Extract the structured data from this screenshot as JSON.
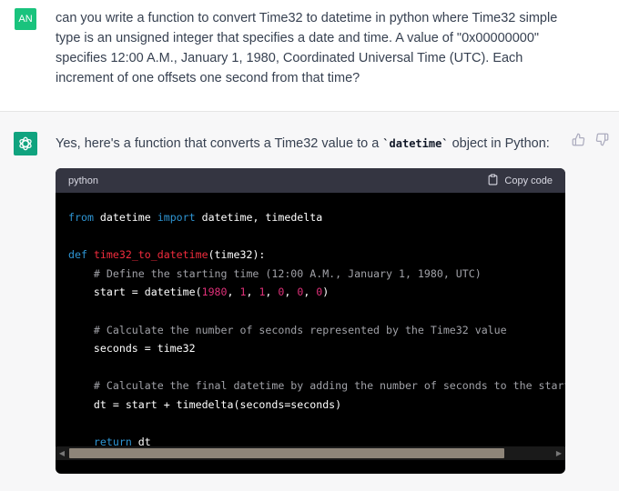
{
  "colors": {
    "user_avatar": "#19c37d",
    "gpt_avatar": "#10a37f",
    "code_bg": "#000000",
    "code_header": "#343541"
  },
  "user_message": {
    "avatar_initials": "AN",
    "text": "can you write a function to convert Time32  to datetime in python where Time32 simple type is an unsigned integer that specifies a date and time. A value of \"0x00000000\" specifies 12:00 A.M., January 1, 1980, Coordinated Universal Time (UTC). Each increment of one offsets one second from that time?"
  },
  "assistant_message": {
    "avatar_icon": "openai-logo-icon",
    "intro_before": "Yes, here's a function that converts a Time32 value to a ",
    "intro_code": "`datetime`",
    "intro_after": " object in Python:",
    "feedback_icons": [
      "thumbs-up-icon",
      "thumbs-down-icon"
    ]
  },
  "code_block": {
    "language": "python",
    "copy_label": "Copy code",
    "lines": [
      [
        {
          "t": "from",
          "c": "kw"
        },
        {
          "t": " datetime "
        },
        {
          "t": "import",
          "c": "kw"
        },
        {
          "t": " datetime, timedelta"
        }
      ],
      [],
      [
        {
          "t": "def",
          "c": "kw"
        },
        {
          "t": " "
        },
        {
          "t": "time32_to_datetime",
          "c": "fn"
        },
        {
          "t": "(time32):"
        }
      ],
      [
        {
          "t": "    "
        },
        {
          "t": "# Define the starting time (12:00 A.M., January 1, 1980, UTC)",
          "c": "cm"
        }
      ],
      [
        {
          "t": "    start = datetime("
        },
        {
          "t": "1980",
          "c": "num"
        },
        {
          "t": ", "
        },
        {
          "t": "1",
          "c": "num"
        },
        {
          "t": ", "
        },
        {
          "t": "1",
          "c": "num"
        },
        {
          "t": ", "
        },
        {
          "t": "0",
          "c": "num"
        },
        {
          "t": ", "
        },
        {
          "t": "0",
          "c": "num"
        },
        {
          "t": ", "
        },
        {
          "t": "0",
          "c": "num"
        },
        {
          "t": ")"
        }
      ],
      [],
      [
        {
          "t": "    "
        },
        {
          "t": "# Calculate the number of seconds represented by the Time32 value",
          "c": "cm"
        }
      ],
      [
        {
          "t": "    seconds = time32"
        }
      ],
      [],
      [
        {
          "t": "    "
        },
        {
          "t": "# Calculate the final datetime by adding the number of seconds to the starti",
          "c": "cm"
        }
      ],
      [
        {
          "t": "    dt = start + timedelta(seconds=seconds)"
        }
      ],
      [],
      [
        {
          "t": "    "
        },
        {
          "t": "return",
          "c": "kw"
        },
        {
          "t": " dt"
        }
      ]
    ]
  }
}
